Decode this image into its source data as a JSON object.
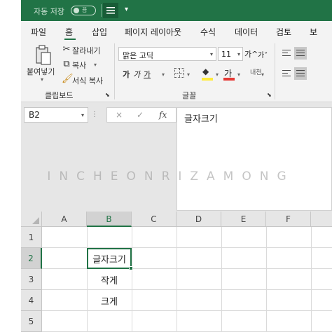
{
  "titlebar": {
    "autosave_label": "자동 저장",
    "autosave_state": "끔",
    "qat_icon": "menu-icon",
    "more_icon": "chevron-down-icon",
    "bg_color": "#217346"
  },
  "ribbon_tabs": [
    "파일",
    "홈",
    "삽입",
    "페이지 레이아웃",
    "수식",
    "데이터",
    "검토",
    "보"
  ],
  "ribbon": {
    "clipboard": {
      "paste_label": "붙여넣기",
      "cut_label": "잘라내기",
      "copy_label": "복사",
      "format_painter_label": "서식 복사",
      "group_label": "클립보드"
    },
    "font": {
      "font_name": "맑은 고딕",
      "font_size": "11",
      "grow_label": "가^",
      "shrink_label": "가˅",
      "bold_label": "가",
      "italic_label": "가",
      "underline_label": "가",
      "fill_label": "◆",
      "font_color_label": "가",
      "phonetic_label": "내천",
      "group_label": "글꼴",
      "fill_color": "#ffeb3b",
      "font_color": "#e53935"
    }
  },
  "formula_bar": {
    "name_box": "B2",
    "cancel_icon": "×",
    "enter_icon": "✓",
    "fx_label": "fx",
    "dots": "⋮",
    "content": "글자크기"
  },
  "watermark": "INCHEONRIZAMONG",
  "sheet": {
    "columns": [
      "A",
      "B",
      "C",
      "D",
      "E",
      "F"
    ],
    "rows": [
      "1",
      "2",
      "3",
      "4",
      "5"
    ],
    "active_cell": "B2",
    "cells": {
      "B2": "글자크기",
      "B3": "작게",
      "B4": "크게"
    },
    "accent": "#217346"
  }
}
